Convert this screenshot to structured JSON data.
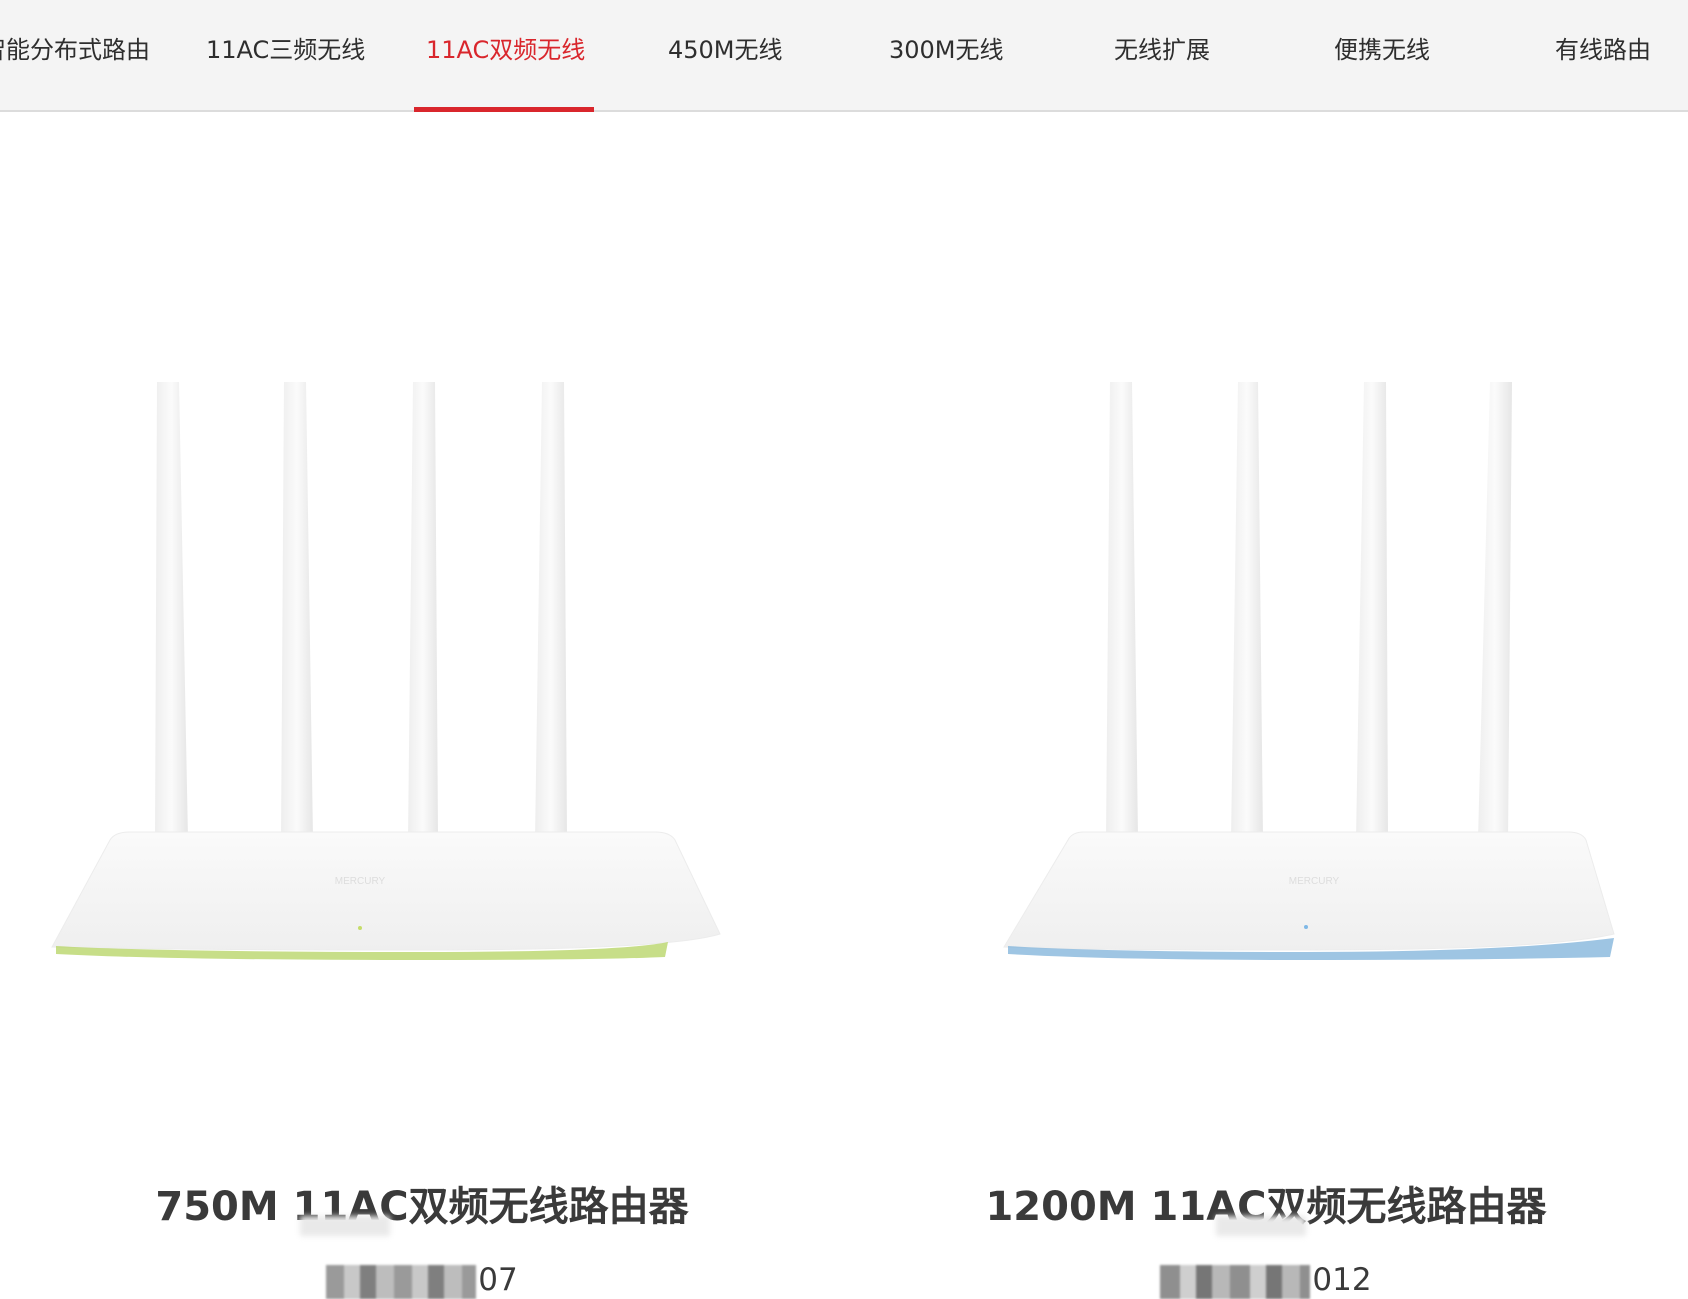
{
  "nav": {
    "tabs": [
      {
        "label": "智能分布式路由"
      },
      {
        "label": "11AC三频无线"
      },
      {
        "label": "11AC双频无线"
      },
      {
        "label": "450M无线"
      },
      {
        "label": "300M无线"
      },
      {
        "label": "无线扩展"
      },
      {
        "label": "便携无线"
      },
      {
        "label": "有线路由"
      }
    ],
    "active_tab": "11AC双频无线",
    "accent_color": "#d9262c"
  },
  "products": [
    {
      "title": "750M 11AC双频无线路由器",
      "model_suffix": "07",
      "image": "router-white-4-antenna-green-trim",
      "trim_color": "#b9d66a",
      "brand_text": "MERCURY"
    },
    {
      "title": "1200M 11AC双频无线路由器",
      "model_suffix": "012",
      "image": "router-white-4-antenna-blue-trim",
      "trim_color": "#86b6dc",
      "brand_text": "MERCURY"
    }
  ]
}
